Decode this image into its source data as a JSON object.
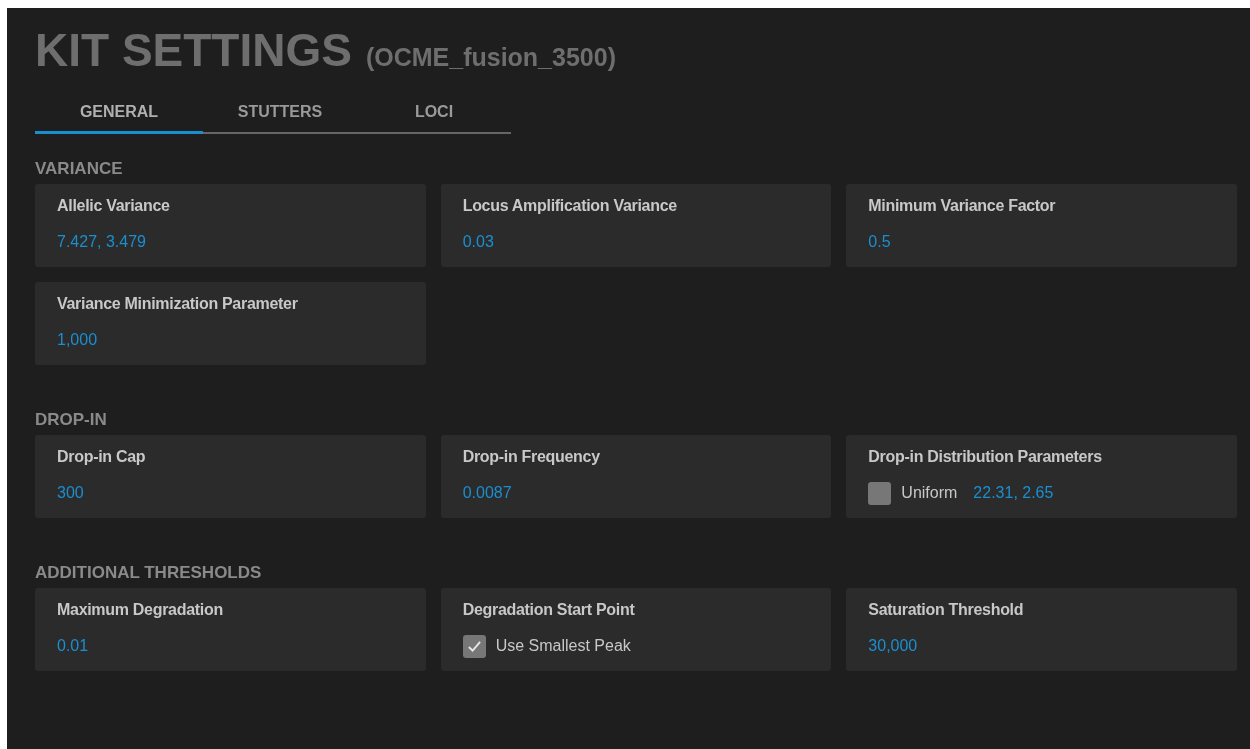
{
  "title": "KIT SETTINGS",
  "subtitle": "(OCME_fusion_3500)",
  "tabs": [
    {
      "label": "GENERAL",
      "selected": true
    },
    {
      "label": "STUTTERS",
      "selected": false
    },
    {
      "label": "LOCI",
      "selected": false
    }
  ],
  "sections": [
    {
      "heading": "VARIANCE",
      "fields": [
        {
          "kind": "value",
          "label": "Allelic Variance",
          "value": "7.427, 3.479"
        },
        {
          "kind": "value",
          "label": "Locus Amplification Variance",
          "value": "0.03"
        },
        {
          "kind": "value",
          "label": "Minimum Variance Factor",
          "value": "0.5"
        },
        {
          "kind": "value",
          "label": "Variance Minimization Parameter",
          "value": "1,000"
        }
      ]
    },
    {
      "heading": "DROP-IN",
      "fields": [
        {
          "kind": "value",
          "label": "Drop-in Cap",
          "value": "300"
        },
        {
          "kind": "value",
          "label": "Drop-in Frequency",
          "value": "0.0087"
        },
        {
          "kind": "checkbox_value",
          "label": "Drop-in Distribution Parameters",
          "option": "Uniform",
          "checked": false,
          "value": "22.31, 2.65"
        }
      ]
    },
    {
      "heading": "ADDITIONAL THRESHOLDS",
      "fields": [
        {
          "kind": "value",
          "label": "Maximum Degradation",
          "value": "0.01"
        },
        {
          "kind": "checkbox",
          "label": "Degradation Start Point",
          "option": "Use Smallest Peak",
          "checked": true
        },
        {
          "kind": "value",
          "label": "Saturation Threshold",
          "value": "30,000"
        }
      ]
    }
  ]
}
